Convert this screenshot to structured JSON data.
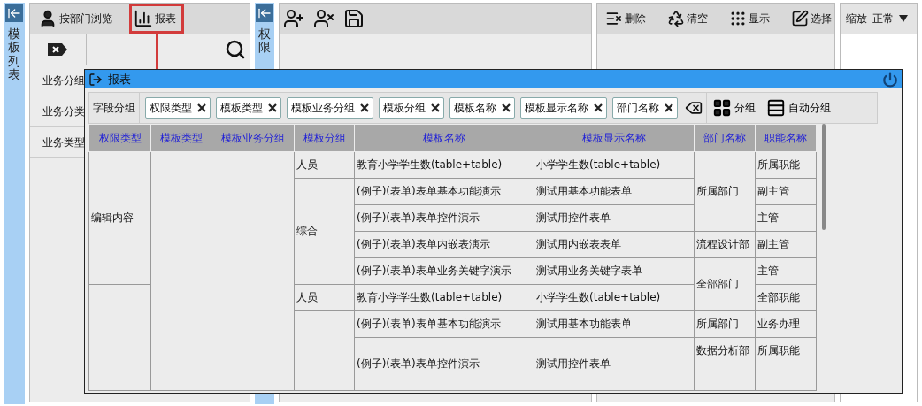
{
  "left_panel": {
    "strip_title": "模板列表",
    "toolbar": [
      {
        "kind": "user",
        "label": "按部门浏览",
        "highlighted": false
      },
      {
        "kind": "chart",
        "label": "报表",
        "highlighted": true
      }
    ],
    "list": [
      "业务分组",
      "业务分类",
      "业务类型"
    ]
  },
  "middle_panel": {
    "strip_title": "权限"
  },
  "right_toolbar": [
    {
      "kind": "delete",
      "label": "删除"
    },
    {
      "kind": "clear",
      "label": "清空"
    },
    {
      "kind": "grid",
      "label": "显示"
    },
    {
      "kind": "select",
      "label": "选择"
    }
  ],
  "zoom": {
    "label": "缩放",
    "value": "正常"
  },
  "dialog": {
    "title": "报表",
    "group_label": "字段分组",
    "chips": [
      "权限类型",
      "模板类型",
      "模板业务分组",
      "模板分组",
      "模板名称",
      "模板显示名称",
      "部门名称"
    ],
    "actions": [
      {
        "kind": "group",
        "label": "分组"
      },
      {
        "kind": "auto",
        "label": "自动分组"
      }
    ],
    "table": {
      "columns": [
        "权限类型",
        "模板类型",
        "模板业务分组",
        "模板分组",
        "模板名称",
        "模板显示名称",
        "部门名称",
        "职能名称"
      ],
      "rows": [
        [
          {
            "text": "编辑内容",
            "rowspan": 5
          },
          {
            "rowspan": 10
          },
          {
            "rowspan": 10
          },
          {
            "text": "人员"
          },
          {
            "text": "教育小学学生数(table+table)"
          },
          {
            "text": "小学学生数(table+table)"
          },
          {
            "text": "所属部门",
            "rowspan": 3
          },
          {
            "text": "所属职能"
          }
        ],
        [
          {
            "text": "综合",
            "rowspan": 4
          },
          {
            "text": "(例子)(表单)表单基本功能演示"
          },
          {
            "text": "测试用基本功能表单"
          },
          {
            "text": "副主管"
          }
        ],
        [
          {
            "text": "(例子)(表单)表单控件演示"
          },
          {
            "text": "测试用控件表单"
          },
          {
            "text": "主管"
          }
        ],
        [
          {
            "text": "(例子)(表单)表单内嵌表演示"
          },
          {
            "text": "测试用内嵌表表单"
          },
          {
            "text": "流程设计部"
          },
          {
            "text": "副主管"
          }
        ],
        [
          {
            "text": "(例子)(表单)表单业务关键字演示"
          },
          {
            "text": "测试用业务关键字表单"
          },
          {
            "text": "全部部门",
            "rowspan": 2
          },
          {
            "text": "主管"
          }
        ],
        [
          {
            "rowspan": 5
          },
          {
            "text": "人员"
          },
          {
            "text": "教育小学学生数(table+table)"
          },
          {
            "text": "小学学生数(table+table)"
          },
          {
            "text": "全部职能"
          }
        ],
        [
          {
            "rowspan": 4
          },
          {
            "text": "(例子)(表单)表单基本功能演示"
          },
          {
            "text": "测试用基本功能表单"
          },
          {
            "text": "所属部门"
          },
          {
            "text": "业务办理"
          }
        ],
        [
          {
            "text": "(例子)(表单)表单控件演示",
            "rowspan": 2
          },
          {
            "text": "测试用控件表单",
            "rowspan": 2
          },
          {
            "text": "数据分析部"
          },
          {
            "text": "所属职能"
          }
        ],
        [
          {},
          {}
        ]
      ]
    }
  }
}
